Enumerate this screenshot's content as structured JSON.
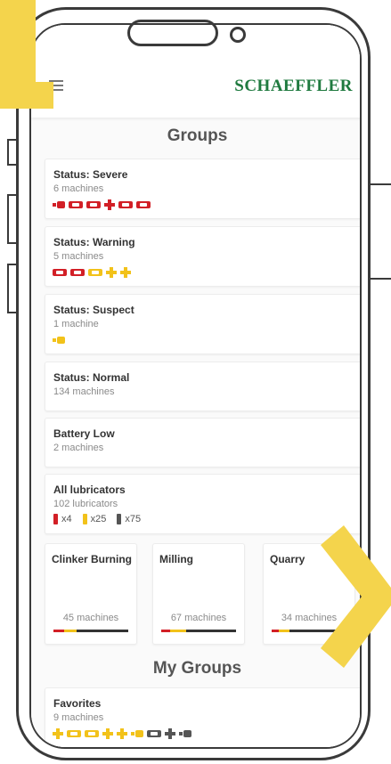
{
  "app": {
    "brand": "SCHAEFFLER"
  },
  "page": {
    "title": "Groups",
    "my_groups_title": "My Groups"
  },
  "groups": [
    {
      "name": "Status: Severe",
      "count": "6 machines"
    },
    {
      "name": "Status: Warning",
      "count": "5 machines"
    },
    {
      "name": "Status: Suspect",
      "count": "1 machine"
    },
    {
      "name": "Status: Normal",
      "count": "134 machines"
    },
    {
      "name": "Battery Low",
      "count": "2 machines"
    },
    {
      "name": "All lubricators",
      "count": "102 lubricators"
    }
  ],
  "lubricators": [
    {
      "label": "x4",
      "color": "#d21f26"
    },
    {
      "label": "x25",
      "color": "#f2c21a"
    },
    {
      "label": "x75",
      "color": "#555555"
    }
  ],
  "tiles": [
    {
      "name": "Clinker Burning",
      "count": "45 machines"
    },
    {
      "name": "Milling",
      "count": "67 machines"
    },
    {
      "name": "Quarry",
      "count": "34 machines"
    }
  ],
  "favorites": {
    "name": "Favorites",
    "count": "9 machines"
  },
  "colors": {
    "severe": "#d21f26",
    "warning": "#f2c21a",
    "brand": "#1f7a3f",
    "accent": "#f4d44c"
  },
  "icons": [
    "menu-icon",
    "machine-icon",
    "motor-icon",
    "plus-icon",
    "lubricator-icon",
    "chevron-right-icon"
  ]
}
